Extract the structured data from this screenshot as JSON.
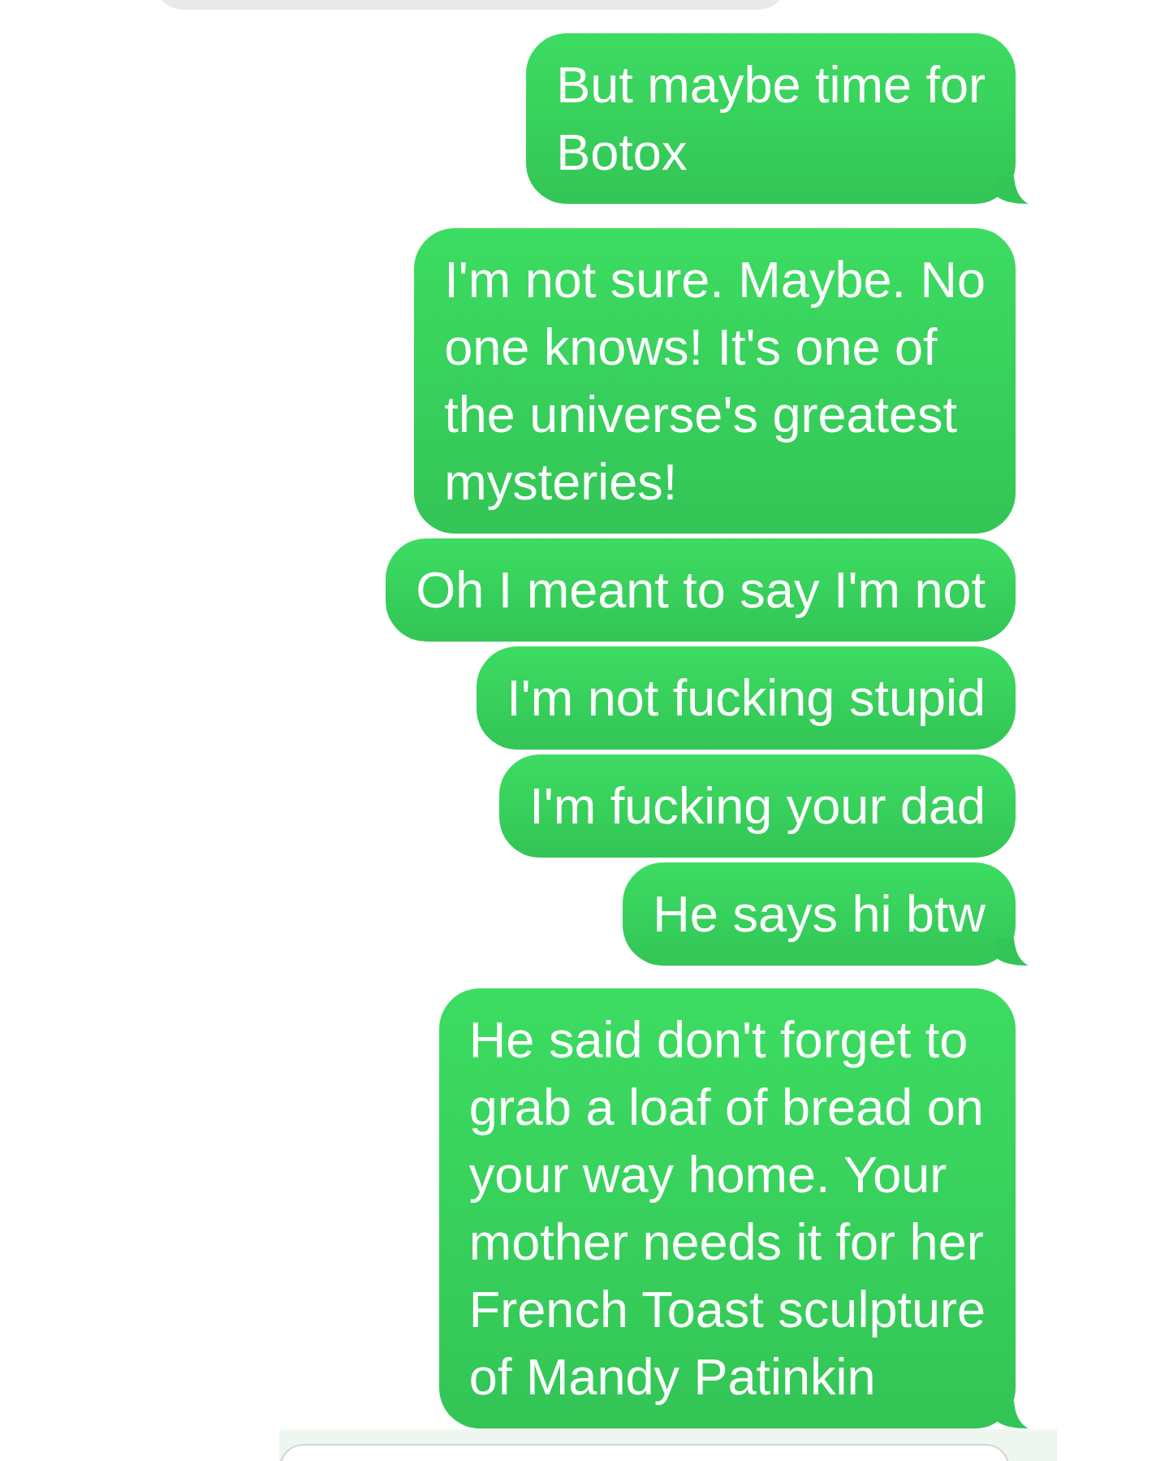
{
  "messages": [
    {
      "text": "But maybe time for\nBotox",
      "tail": true
    },
    {
      "text": "I'm not sure. Maybe. No\none knows! It's one of\nthe universe's greatest\nmysteries!",
      "tail": false
    },
    {
      "text": "Oh I meant to say I'm not",
      "tail": false
    },
    {
      "text": "I'm not fucking stupid",
      "tail": false
    },
    {
      "text": "I'm fucking your dad",
      "tail": false
    },
    {
      "text": "He says hi btw",
      "tail": true
    },
    {
      "text": "He said don't forget to\ngrab a loaf of bread on\nyour way home. Your\nmother needs it for her\nFrench Toast sculpture\nof Mandy Patinkin",
      "tail": true
    }
  ]
}
